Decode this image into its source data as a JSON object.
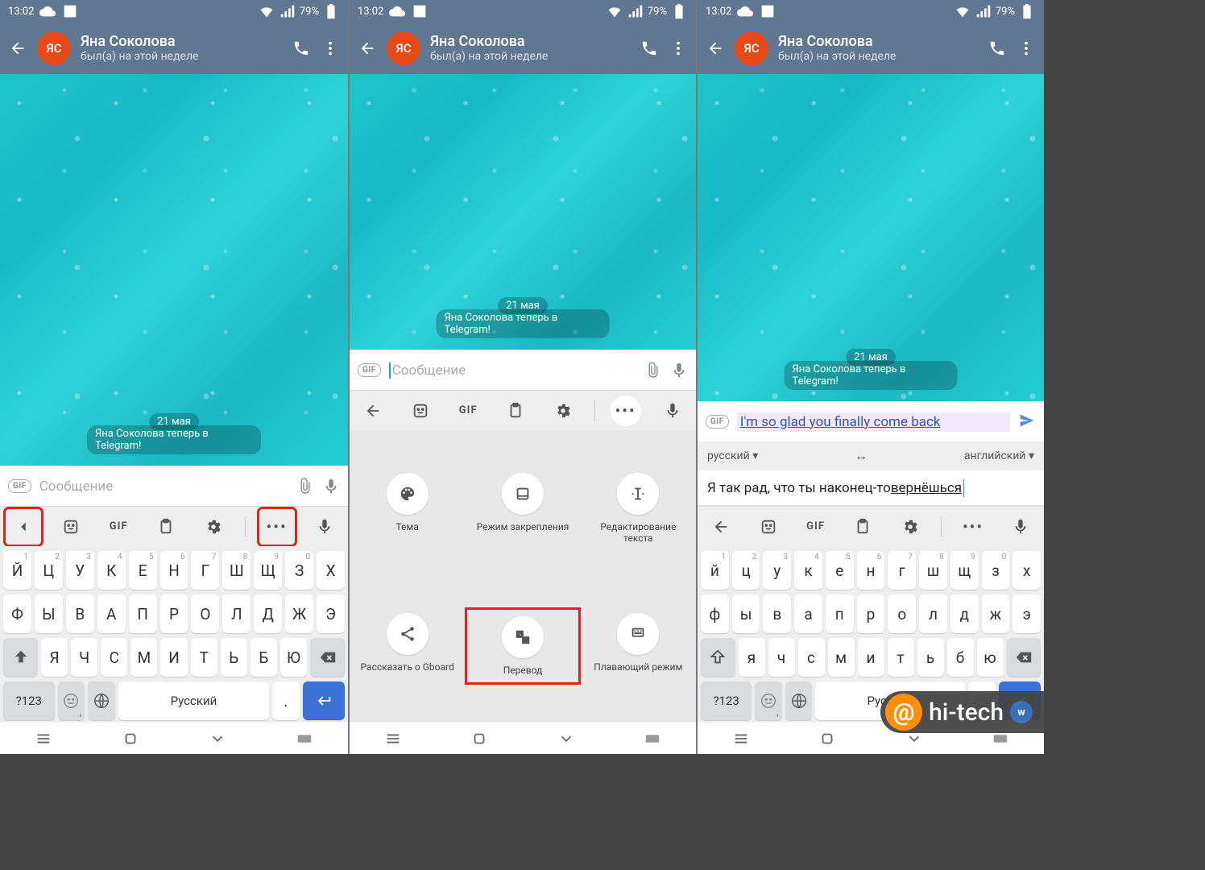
{
  "status": {
    "time": "13:02",
    "battery": "79%"
  },
  "header": {
    "avatar_initials": "ЯС",
    "name": "Яна Соколова",
    "last_seen": "был(а) на этой неделе"
  },
  "chat": {
    "date": "21 мая",
    "system_msg": "Яна Соколова теперь в Telegram!"
  },
  "input": {
    "placeholder": "Сообщение",
    "gif": "GIF",
    "typed_en": "I'm so glad you finally come back"
  },
  "translate": {
    "from": "русский",
    "to": "английский",
    "text_prefix": "Я так  рад, что ты наконец-то ",
    "text_underlined": "вернёшься"
  },
  "kb_toolbar": {
    "gif": "GIF"
  },
  "keyboard": {
    "row1": [
      [
        "й",
        "1"
      ],
      [
        "ц",
        "2"
      ],
      [
        "у",
        "3"
      ],
      [
        "к",
        "4"
      ],
      [
        "е",
        "5"
      ],
      [
        "н",
        "6"
      ],
      [
        "г",
        "7"
      ],
      [
        "ш",
        "8"
      ],
      [
        "щ",
        "9"
      ],
      [
        "з",
        "0"
      ],
      [
        "х",
        ""
      ]
    ],
    "row2": [
      "ф",
      "ы",
      "в",
      "а",
      "п",
      "р",
      "о",
      "л",
      "д",
      "ж",
      "э"
    ],
    "row3": [
      "я",
      "ч",
      "с",
      "м",
      "и",
      "т",
      "ь",
      "б",
      "ю"
    ],
    "sym": "?123",
    "space": "Русский",
    "dot": "."
  },
  "gmenu": {
    "items": [
      [
        "Тема",
        "Режим закрепления",
        "Редактирование текста"
      ],
      [
        "Рассказать о Gboard",
        "Перевод",
        "Плавающий режим"
      ]
    ]
  },
  "watermark": {
    "text": "hi-tech"
  }
}
